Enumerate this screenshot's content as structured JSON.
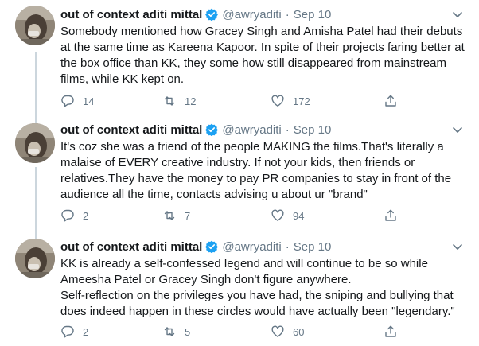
{
  "tweets": [
    {
      "author_name": "out of context aditi mittal",
      "handle": "@awryaditi",
      "date": "Sep 10",
      "text": "Somebody mentioned how Gracey Singh and Amisha Patel had their debuts\nat the same time as Kareena Kapoor. In spite of their projects faring better at\nthe box office than KK, they some how still disappeared from mainstream\nfilms, while KK kept on.",
      "replies": "14",
      "retweets": "12",
      "likes": "172"
    },
    {
      "author_name": "out of context aditi mittal",
      "handle": "@awryaditi",
      "date": "Sep 10",
      "text": "It's coz she was a friend of the people MAKING the films.That's literally a\nmalaise of EVERY creative industry. If not your kids, then friends or\nrelatives.They have  the money to pay PR companies to stay in front of the\naudience all the time, contacts advising u about ur \"brand\"",
      "replies": "2",
      "retweets": "7",
      "likes": "94"
    },
    {
      "author_name": "out of context aditi mittal",
      "handle": "@awryaditi",
      "date": "Sep 10",
      "text": "KK is already a self-confessed legend and will continue to be so while\nAmeesha Patel or Gracey Singh don't figure anywhere.\nSelf-reflection on the privileges you have had, the sniping and bullying that\ndoes indeed happen in these circles would have actually been \"legendary.\"",
      "replies": "2",
      "retweets": "5",
      "likes": "60"
    }
  ],
  "separator": "·",
  "icons": {
    "verified": "verified-badge-icon",
    "caret": "chevron-down-icon",
    "reply": "reply-icon",
    "retweet": "retweet-icon",
    "like": "heart-icon",
    "share": "share-icon"
  },
  "colors": {
    "text": "#14171a",
    "secondary": "#657786",
    "verified": "#1da1f2",
    "thread_line": "#ccd6dd"
  }
}
